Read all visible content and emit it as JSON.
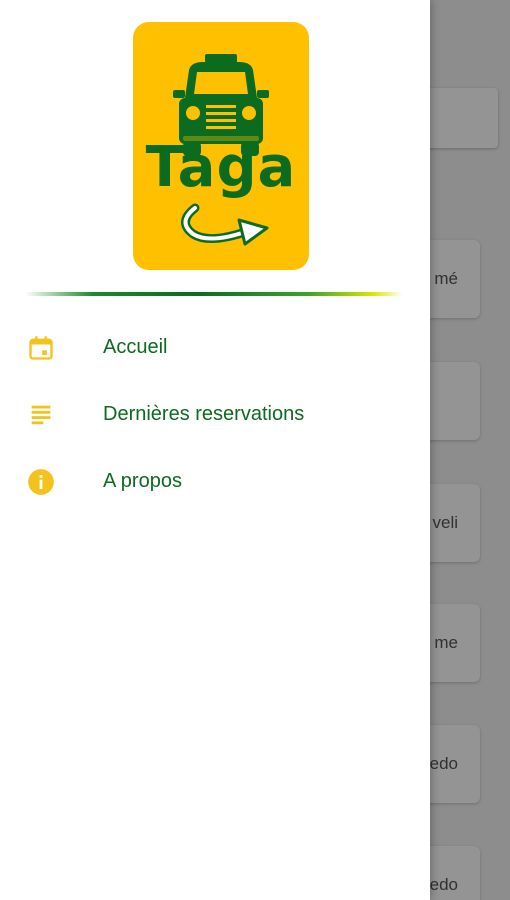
{
  "colors": {
    "brand_yellow": "#FFC000",
    "brand_green": "#0B6B1F",
    "icon_yellow": "#F3C21C",
    "scrim": "rgba(0,0,0,0.42)"
  },
  "drawer": {
    "logo": {
      "text": "Taga",
      "icon": "taxi-logo-icon"
    },
    "menu": [
      {
        "label": "Accueil",
        "icon": "calendar-icon"
      },
      {
        "label": "Dernières reservations",
        "icon": "list-icon"
      },
      {
        "label": "A propos",
        "icon": "info-icon"
      }
    ]
  },
  "background_cards": [
    {
      "text": "mé"
    },
    {
      "text": ""
    },
    {
      "text": "veli"
    },
    {
      "text": "me"
    },
    {
      "text": "edo"
    },
    {
      "text": "edo"
    }
  ]
}
